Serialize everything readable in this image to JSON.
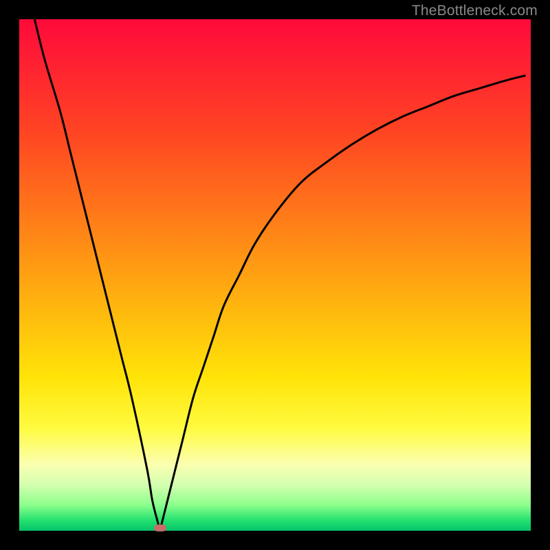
{
  "watermark": "TheBottleneck.com",
  "colors": {
    "background": "#000000",
    "curve": "#000000",
    "marker": "#c76b6b"
  },
  "chart_data": {
    "type": "line",
    "title": "",
    "xlabel": "",
    "ylabel": "",
    "xlim": [
      0,
      100
    ],
    "ylim": [
      0,
      100
    ],
    "grid": false,
    "legend": false,
    "series": [
      {
        "name": "curve",
        "x": [
          3,
          5,
          8,
          10,
          12,
          15,
          18,
          20,
          22,
          25,
          26,
          27,
          27.5,
          28,
          30,
          32,
          34,
          36,
          38,
          40,
          43,
          46,
          50,
          55,
          60,
          65,
          70,
          75,
          80,
          85,
          90,
          95,
          99
        ],
        "y": [
          100,
          92,
          82,
          74,
          66,
          54,
          42,
          34,
          26,
          12,
          6,
          2,
          0.5,
          2,
          10,
          18,
          26,
          32,
          38,
          44,
          50,
          56,
          62,
          68,
          72,
          75.5,
          78.5,
          81,
          83,
          85,
          86.5,
          88,
          89
        ]
      }
    ],
    "annotations": [
      {
        "type": "min-marker",
        "x": 27.5,
        "y": 0.5
      }
    ]
  }
}
